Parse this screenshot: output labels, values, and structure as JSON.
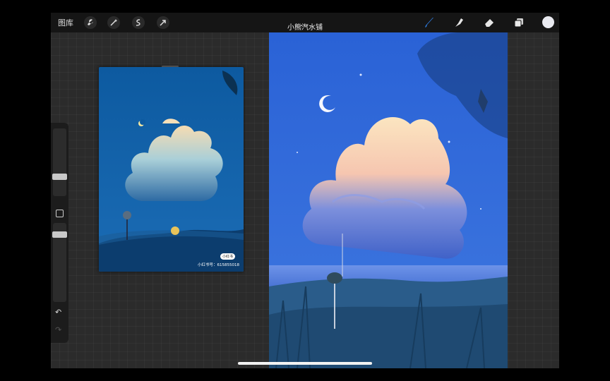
{
  "topbar": {
    "gallery_label": "图库",
    "title": "小熊汽水铺",
    "left_tools": [
      "wrench-icon",
      "magic-wand-icon",
      "selection-icon",
      "transform-arrow-icon"
    ],
    "right_tools": [
      "brush-icon",
      "smudge-icon",
      "eraser-icon",
      "layers-icon"
    ],
    "accent": "#2f7de1",
    "current_color": "#e9eaf0"
  },
  "sidebar": {
    "modify_label": "",
    "undo_symbol": "↶",
    "redo_symbol": "↷"
  },
  "reference": {
    "badge": "小红书",
    "id_text": "小红书号：615855018"
  }
}
